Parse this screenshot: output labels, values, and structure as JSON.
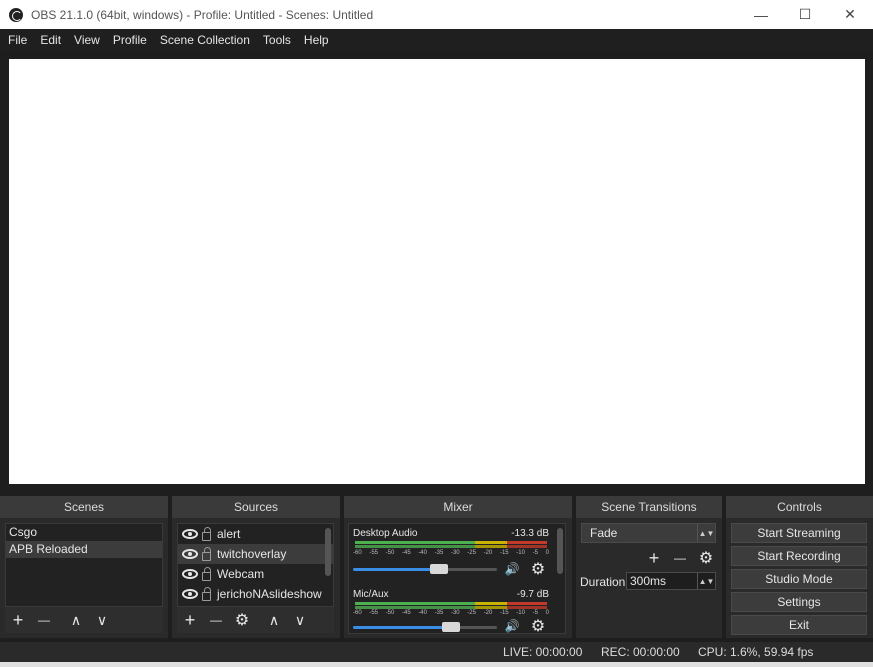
{
  "window": {
    "title": "OBS 21.1.0 (64bit, windows) - Profile: Untitled - Scenes: Untitled",
    "minimize_glyph": "—",
    "maximize_glyph": "☐",
    "close_glyph": "✕"
  },
  "menu": [
    "File",
    "Edit",
    "View",
    "Profile",
    "Scene Collection",
    "Tools",
    "Help"
  ],
  "docks": {
    "scenes": "Scenes",
    "sources": "Sources",
    "mixer": "Mixer",
    "transitions": "Scene Transitions",
    "controls": "Controls"
  },
  "scenes": {
    "items": [
      "Csgo",
      "APB Reloaded"
    ],
    "selected_index": 1
  },
  "sources": {
    "items": [
      "alert",
      "twitchoverlay",
      "Webcam",
      "jerichoNAslideshow"
    ],
    "selected_index": 1
  },
  "mixer": {
    "scale": [
      "-60",
      "-55",
      "-50",
      "-45",
      "-40",
      "-35",
      "-30",
      "-25",
      "-20",
      "-15",
      "-10",
      "-5",
      "0"
    ],
    "channels": [
      {
        "name": "Desktop Audio",
        "db": "-13.3 dB",
        "volume": 0.6
      },
      {
        "name": "Mic/Aux",
        "db": "-9.7 dB",
        "volume": 0.68
      }
    ]
  },
  "transitions": {
    "type": "Fade",
    "duration_label": "Duration",
    "duration_value": "300ms"
  },
  "controls": [
    "Start Streaming",
    "Start Recording",
    "Studio Mode",
    "Settings",
    "Exit"
  ],
  "status": {
    "live": "LIVE: 00:00:00",
    "rec": "REC: 00:00:00",
    "cpu": "CPU: 1.6%, 59.94 fps"
  },
  "icons": {
    "plus": "+",
    "minus": "—",
    "up": "∧",
    "down": "∨",
    "gear": "⚙",
    "speaker": "🔊"
  },
  "colors": {
    "meter_green": "#4caf50",
    "meter_yellow": "#c8b400",
    "meter_red": "#c0392b",
    "slider_blue": "#3a8ee6"
  }
}
